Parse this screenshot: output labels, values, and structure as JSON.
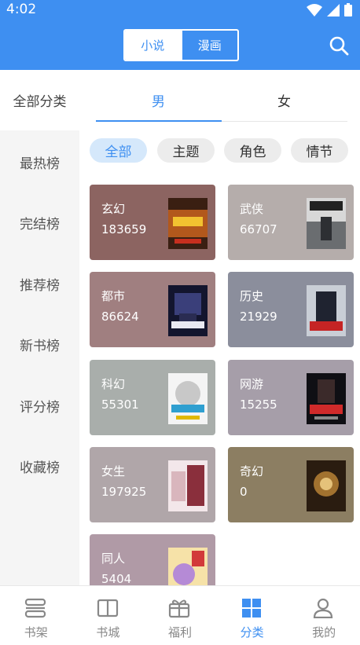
{
  "status_bar": {
    "time": "4:02"
  },
  "header": {
    "toggle": [
      {
        "label": "小说",
        "active": true
      },
      {
        "label": "漫画",
        "active": false
      }
    ],
    "search_icon": "search-icon"
  },
  "sidebar": {
    "all_label": "全部分类",
    "items": [
      {
        "label": "最热榜"
      },
      {
        "label": "完结榜"
      },
      {
        "label": "推荐榜"
      },
      {
        "label": "新书榜"
      },
      {
        "label": "评分榜"
      },
      {
        "label": "收藏榜"
      }
    ]
  },
  "gender_tabs": [
    {
      "label": "男",
      "active": true
    },
    {
      "label": "女",
      "active": false
    }
  ],
  "filters": [
    {
      "label": "全部",
      "active": true
    },
    {
      "label": "主题",
      "active": false
    },
    {
      "label": "角色",
      "active": false
    },
    {
      "label": "情节",
      "active": false
    }
  ],
  "categories": [
    {
      "name": "玄幻",
      "count": "183659",
      "color": "#8c6461"
    },
    {
      "name": "武侠",
      "count": "66707",
      "color": "#b5adab"
    },
    {
      "name": "都市",
      "count": "86624",
      "color": "#a07f80"
    },
    {
      "name": "历史",
      "count": "21929",
      "color": "#8b8e9c"
    },
    {
      "name": "科幻",
      "count": "55301",
      "color": "#a9aeab"
    },
    {
      "name": "网游",
      "count": "15255",
      "color": "#a69ea9"
    },
    {
      "name": "女生",
      "count": "197925",
      "color": "#b0a6a9"
    },
    {
      "name": "奇幻",
      "count": "0",
      "color": "#8c7e62"
    },
    {
      "name": "同人",
      "count": "5404",
      "color": "#b09aa6"
    }
  ],
  "tabbar": [
    {
      "label": "书架",
      "icon": "bookshelf-icon",
      "active": false
    },
    {
      "label": "书城",
      "icon": "book-icon",
      "active": false
    },
    {
      "label": "福利",
      "icon": "gift-icon",
      "active": false
    },
    {
      "label": "分类",
      "icon": "category-grid-icon",
      "active": true
    },
    {
      "label": "我的",
      "icon": "user-icon",
      "active": false
    }
  ]
}
